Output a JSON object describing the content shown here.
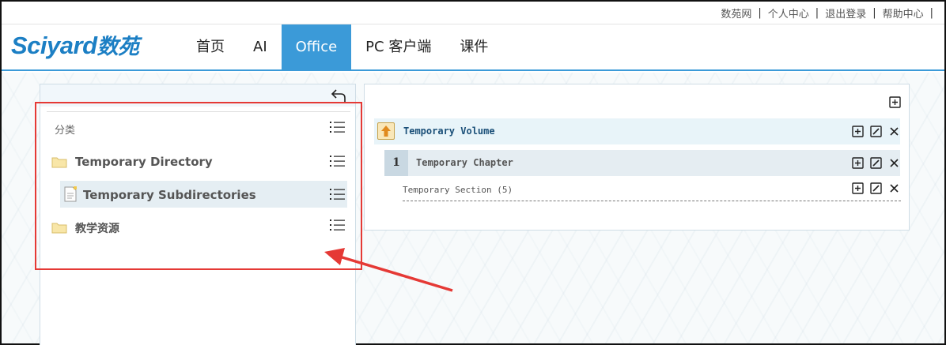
{
  "top_links": [
    "数苑网",
    "个人中心",
    "退出登录",
    "帮助中心"
  ],
  "logo": {
    "latin": "Sciyard",
    "cn": "数苑"
  },
  "nav": [
    "首页",
    "AI",
    "Office",
    "PC 客户端",
    "课件"
  ],
  "nav_active": "Office",
  "sidebar": {
    "header": "分类",
    "items": [
      {
        "label": "Temporary Directory",
        "icon": "folder-icon"
      },
      {
        "label": "Temporary Subdirectories",
        "icon": "document-icon",
        "selected": true
      },
      {
        "label": "教学资源",
        "icon": "folder-icon"
      }
    ]
  },
  "content": {
    "volume": "Temporary Volume",
    "chapter_number": "1",
    "chapter": "Temporary Chapter",
    "section": "Temporary Section (5)"
  },
  "colors": {
    "accent": "#3b9ad8",
    "highlight": "#e53935",
    "logo": "#1c7fc4"
  }
}
